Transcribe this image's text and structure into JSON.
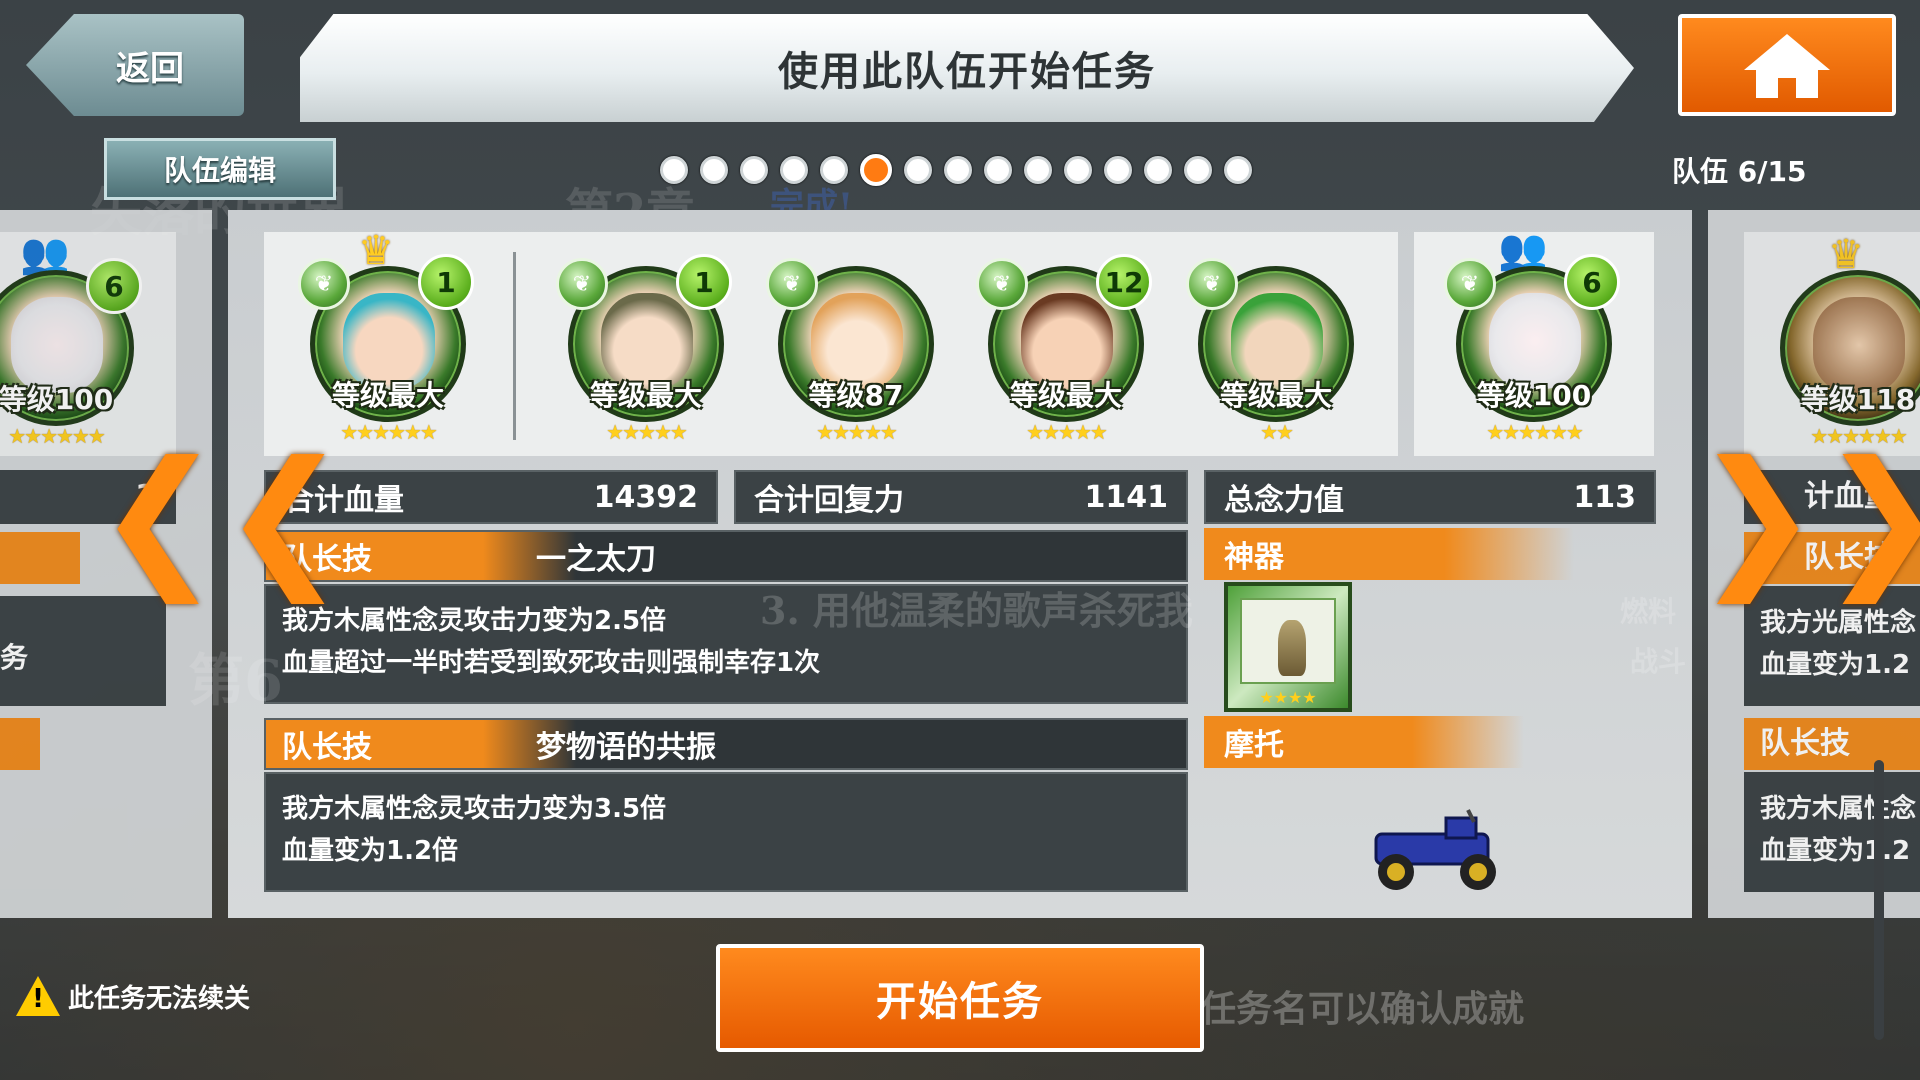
{
  "header": {
    "back_label": "返回",
    "title": "使用此队伍开始任务",
    "home_icon": "home-icon"
  },
  "team_edit_label": "队伍编辑",
  "pagination": {
    "total": 15,
    "active_index": 6
  },
  "team_counter": "队伍 6/15",
  "background_text": {
    "t1": "失落的世界",
    "t2": "第2章",
    "t3": "完成!",
    "t4": "3. 用他温柔的歌声杀死我",
    "t5": "燃料",
    "t6": "战斗",
    "t7": "第6",
    "t8": "任务名可以确认成就"
  },
  "units": [
    {
      "level": "等级最大",
      "badge": "1",
      "stars": "★★★★★★",
      "leader": true
    },
    {
      "level": "等级最大",
      "badge": "1",
      "stars": "★★★★★"
    },
    {
      "level": "等级87",
      "badge": "",
      "stars": "★★★★★"
    },
    {
      "level": "等级最大",
      "badge": "12",
      "stars": "★★★★★"
    },
    {
      "level": "等级最大",
      "badge": "",
      "stars": "★★"
    }
  ],
  "friend_unit": {
    "level": "等级100",
    "badge": "6",
    "stars": "★★★★★★"
  },
  "left_peek_unit": {
    "level": "等级100",
    "badge": "6",
    "stars": "★★★★★★"
  },
  "right_peek_unit": {
    "level": "等级118",
    "badge": "",
    "stars": "★★★★★★"
  },
  "stats": {
    "hp_label": "合计血量",
    "hp_value": "14392",
    "recovery_label": "合计回复力",
    "recovery_value": "1141",
    "willpower_label": "总念力值",
    "willpower_value": "113"
  },
  "leader_skill_1": {
    "tag": "队长技",
    "name": "一之太刀",
    "line1": "我方木属性念灵攻击力变为2.5倍",
    "line2": "血量超过一半时若受到致死攻击则强制幸存1次"
  },
  "leader_skill_2": {
    "tag": "队长技",
    "name": "梦物语的共振",
    "line1": "我方木属性念灵攻击力变为3.5倍",
    "line2": "血量变为1.2倍"
  },
  "artifact_label": "神器",
  "artifact_stars": "★★★★",
  "vehicle_label": "摩托",
  "right_peek": {
    "hp_label": "计血量",
    "skill_tag": "队长技",
    "line1": "我方光属性念",
    "line2": "血量变为1.2",
    "skill_tag2": "队长技",
    "line3": "我方木属性念",
    "line4": "血量变为1.2"
  },
  "left_peek": {
    "value": "1",
    "text": "务"
  },
  "start_label": "开始任务",
  "warning_text": "此任务无法续关",
  "colors": {
    "accent": "#f08a1c",
    "panel": "#3b4245",
    "button": "#e65a00"
  }
}
